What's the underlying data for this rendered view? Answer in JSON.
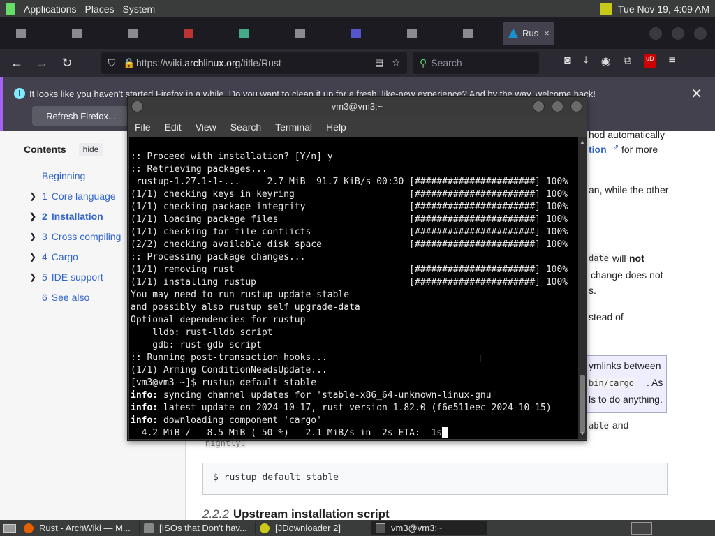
{
  "top_panel": {
    "menus": [
      "Applications",
      "Places",
      "System"
    ],
    "clock": "Tue Nov 19,  4:09 AM"
  },
  "browser": {
    "active_tab": {
      "title": "Rus",
      "close": "×"
    },
    "url": {
      "prefix": "https://wiki.",
      "domain": "archlinux.org",
      "path": "/title/Rust"
    },
    "search_placeholder": "Search",
    "notification": {
      "message": "It looks like you haven't started Firefox in a while. Do you want to clean it up for a fresh, like-new experience? And by the way, welcome back!",
      "refresh_label": "Refresh Firefox...",
      "close": "✕"
    }
  },
  "wiki": {
    "toc": {
      "title": "Contents",
      "hide": "hide",
      "items": [
        {
          "num": "",
          "label": "Beginning"
        },
        {
          "num": "1",
          "label": "Core language"
        },
        {
          "num": "2",
          "label": "Installation"
        },
        {
          "num": "3",
          "label": "Cross compiling"
        },
        {
          "num": "4",
          "label": "Cargo"
        },
        {
          "num": "5",
          "label": "IDE support"
        },
        {
          "num": "6",
          "label": "See also"
        }
      ]
    },
    "snippets": {
      "s1": "hod automatically",
      "s2": "tion",
      "s3": "for more",
      "s4": "an, while the other",
      "s5": "date",
      "s6": "will",
      "s7": "not",
      "s8": "change does not",
      "s9": "s.",
      "s10": "stead of",
      "s11": "ymlinks between",
      "s12": "bin/cargo",
      "s13": ". As",
      "s14": "ls to do anything.",
      "s15": "able",
      "s16": "and",
      "s17": "nightly."
    },
    "command": "$ rustup default stable",
    "section_num": "2.2.2",
    "section_title": "Upstream installation script"
  },
  "terminal": {
    "title": "vm3@vm3:~",
    "menus": [
      "File",
      "Edit",
      "View",
      "Search",
      "Terminal",
      "Help"
    ],
    "lines": [
      ":: Proceed with installation? [Y/n] y",
      ":: Retrieving packages...",
      " rustup-1.27.1-1-...     2.7 MiB  91.7 KiB/s 00:30 [######################] 100%",
      "(1/1) checking keys in keyring                     [######################] 100%",
      "(1/1) checking package integrity                   [######################] 100%",
      "(1/1) loading package files                        [######################] 100%",
      "(1/1) checking for file conflicts                  [######################] 100%",
      "(2/2) checking available disk space                [######################] 100%",
      ":: Processing package changes...",
      "(1/1) removing rust                                [######################] 100%",
      "(1/1) installing rustup                            [######################] 100%",
      "You may need to run rustup update stable",
      "and possibly also rustup self upgrade-data",
      "Optional dependencies for rustup",
      "    lldb: rust-lldb script",
      "    gdb: rust-gdb script",
      ":: Running post-transaction hooks...",
      "(1/1) Arming ConditionNeedsUpdate...",
      "[vm3@vm3 ~]$ rustup default stable"
    ],
    "info_prefix": "info:",
    "info_lines": [
      " syncing channel updates for 'stable-x86_64-unknown-linux-gnu'",
      " latest update on 2024-10-17, rust version 1.82.0 (f6e511eec 2024-10-15)",
      " downloading component 'cargo'"
    ],
    "progress_line": "  4.2 MiB /   8.5 MiB ( 50 %)   2.1 MiB/s in  2s ETA:  1s"
  },
  "taskbar": {
    "tasks": [
      "Rust - ArchWiki — M...",
      "[ISOs that Don't hav...",
      "[JDownloader 2]",
      "vm3@vm3:~"
    ]
  }
}
